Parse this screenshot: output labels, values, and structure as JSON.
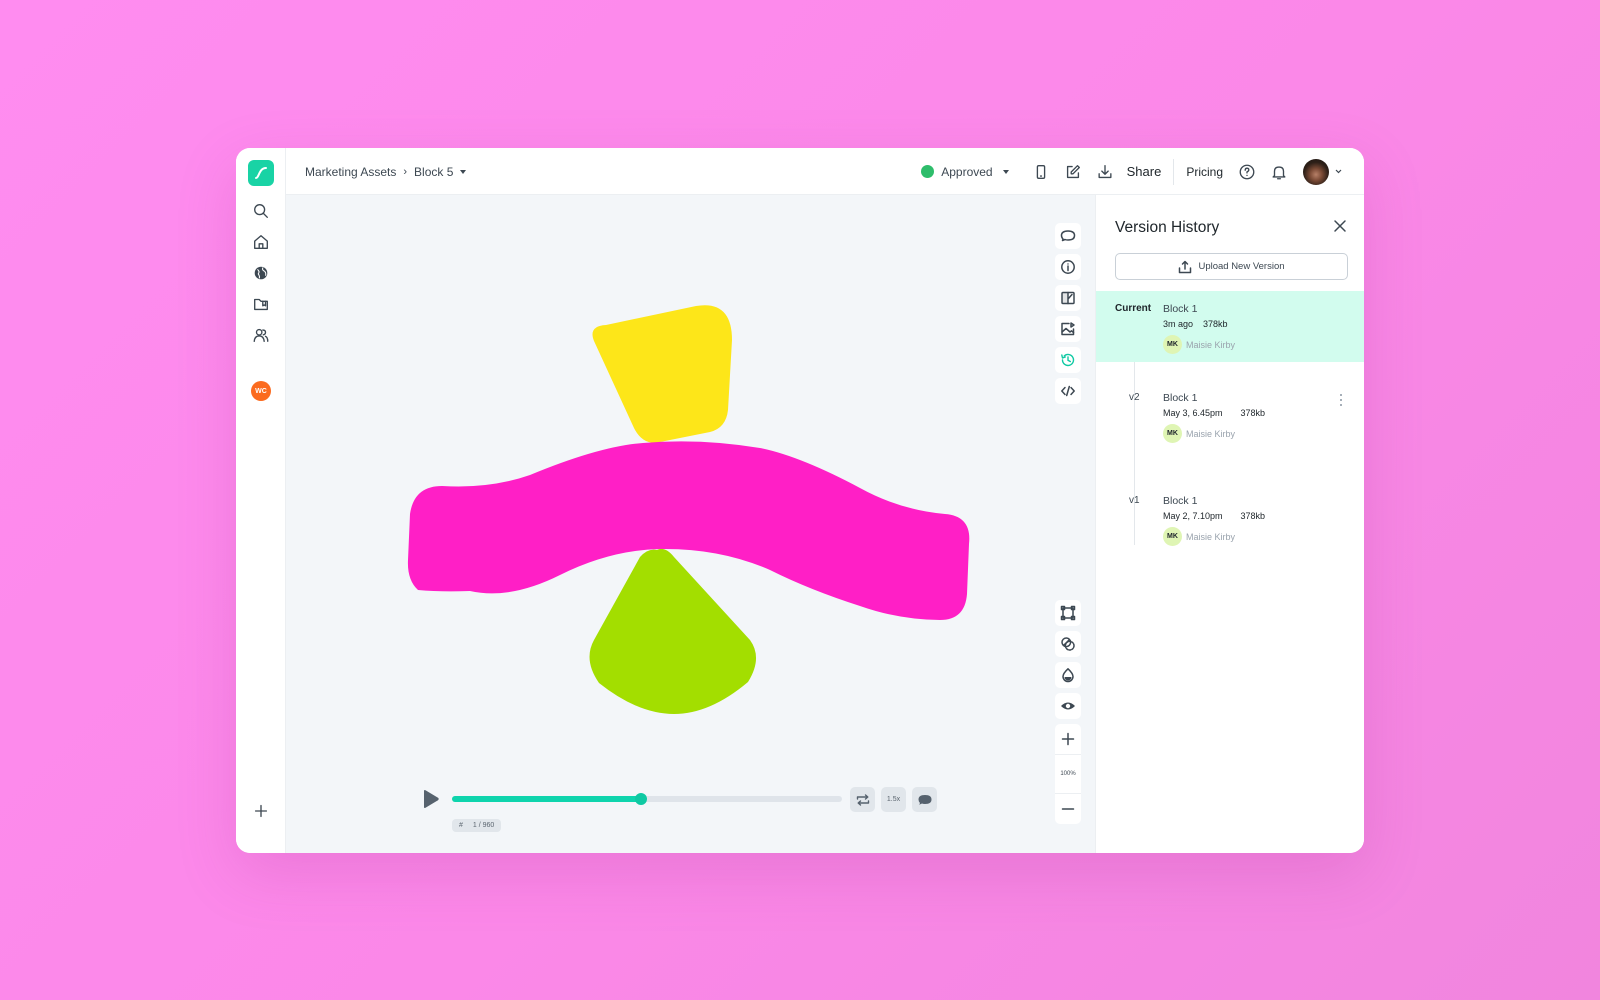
{
  "app": {
    "logo_icon": "lottiefiles-logo-icon",
    "workspace_initials": "WC"
  },
  "sidebar": {
    "items": [
      {
        "name": "search",
        "icon": "search-icon"
      },
      {
        "name": "home",
        "icon": "home-icon"
      },
      {
        "name": "discover",
        "icon": "globe-icon"
      },
      {
        "name": "projects",
        "icon": "folder-icon"
      },
      {
        "name": "team",
        "icon": "users-icon"
      }
    ],
    "add_icon": "plus-icon"
  },
  "topbar": {
    "breadcrumb": [
      "Marketing Assets",
      "Block 5"
    ],
    "status_label": "Approved",
    "status_color": "#2ebd6b",
    "share_label": "Share",
    "pricing_label": "Pricing",
    "icons": [
      "mobile-preview-icon",
      "edit-icon",
      "download-icon",
      "help-icon",
      "bell-icon"
    ]
  },
  "canvas": {
    "background": "#f3f6f9",
    "shapes": [
      {
        "name": "yellow-shape",
        "color": "#fde619"
      },
      {
        "name": "magenta-shape",
        "color": "#ff1fc6"
      },
      {
        "name": "green-shape",
        "color": "#a3de00"
      }
    ],
    "tools_top": [
      "comment-icon",
      "info-icon",
      "theme-icon",
      "image-export-icon",
      "history-icon",
      "code-icon"
    ],
    "tools_bottom": [
      "bounding-box-icon",
      "blend-icon",
      "opacity-icon",
      "eye-icon"
    ],
    "zoom_level": "100%",
    "accent": "#0ed4ad"
  },
  "player": {
    "progress_fraction": 0.485,
    "frame_label": "1 / 960",
    "frame_prefix": "#",
    "speed_label": "1.5x"
  },
  "version_panel": {
    "title": "Version History",
    "upload_label": "Upload New Version",
    "versions": [
      {
        "label": "Current",
        "name": "Block 1",
        "time": "3m ago",
        "size": "378kb",
        "initials": "MK",
        "user": "Maisie Kirby"
      },
      {
        "label": "v2",
        "name": "Block 1",
        "time": "May 3, 6.45pm",
        "size": "378kb",
        "initials": "MK",
        "user": "Maisie Kirby"
      },
      {
        "label": "v1",
        "name": "Block 1",
        "time": "May 2, 7.10pm",
        "size": "378kb",
        "initials": "MK",
        "user": "Maisie Kirby"
      }
    ]
  }
}
